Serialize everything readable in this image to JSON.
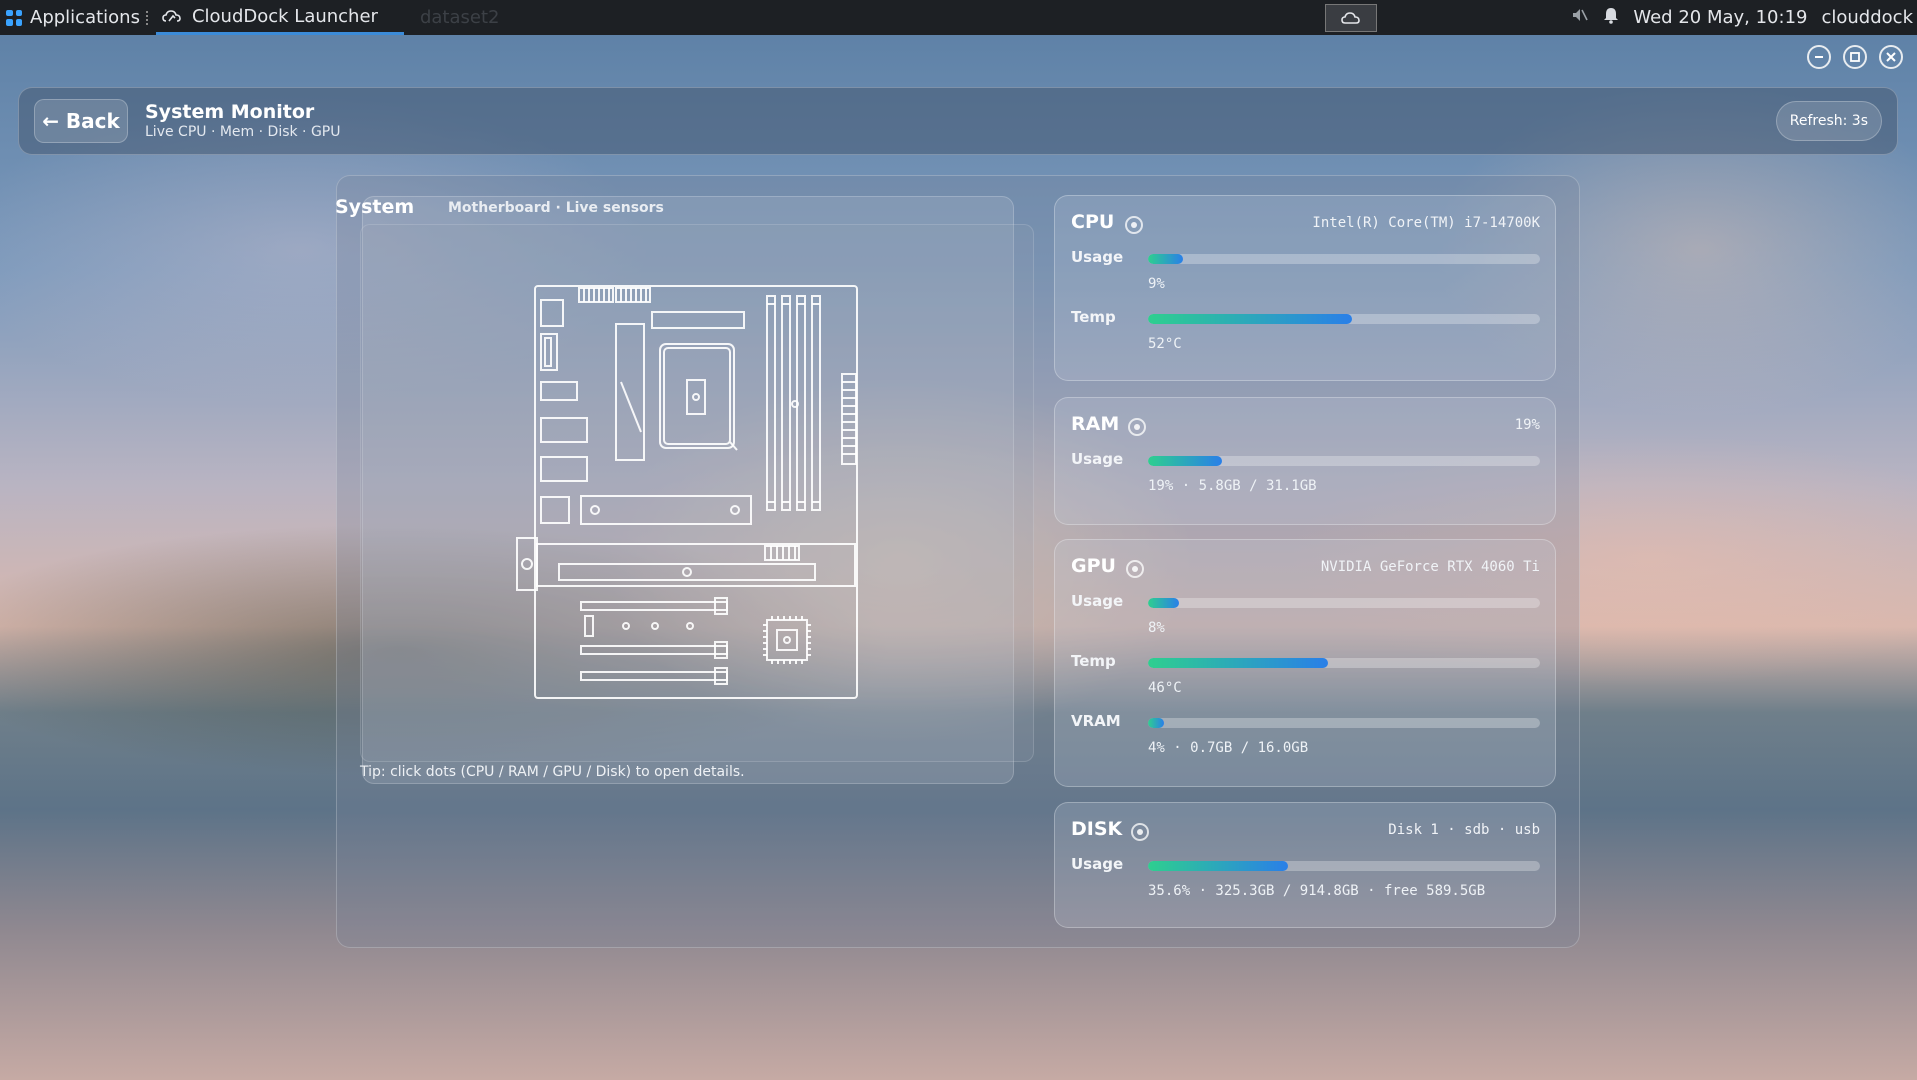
{
  "taskbar": {
    "applications_label": "Applications",
    "active_task_label": "CloudDock Launcher",
    "ghost_task_label": "dataset2",
    "datetime": "Wed 20 May, 10:19",
    "user": "clouddock"
  },
  "header": {
    "back_label": "← Back",
    "title": "System Monitor",
    "subtitle": "Live CPU · Mem · Disk · GPU",
    "refresh_label": "Refresh: 3s"
  },
  "system_panel": {
    "title": "System",
    "subtitle": "Motherboard · Live sensors",
    "tip": "Tip: click dots (CPU / RAM / GPU / Disk) to open details."
  },
  "cpu": {
    "title": "CPU",
    "info": "Intel(R) Core(TM) i7-14700K",
    "usage_label": "Usage",
    "usage_value": "9%",
    "usage_fraction": 0.09,
    "temp_label": "Temp",
    "temp_value": "52°C",
    "temp_fraction": 0.52
  },
  "ram": {
    "title": "RAM",
    "info": "19%",
    "usage_label": "Usage",
    "usage_value": "19% · 5.8GB / 31.1GB",
    "usage_fraction": 0.19
  },
  "gpu": {
    "title": "GPU",
    "info": "NVIDIA GeForce RTX 4060 Ti",
    "usage_label": "Usage",
    "usage_value": "8%",
    "usage_fraction": 0.08,
    "temp_label": "Temp",
    "temp_value": "46°C",
    "temp_fraction": 0.46,
    "vram_label": "VRAM",
    "vram_value": "4% · 0.7GB / 16.0GB",
    "vram_fraction": 0.04
  },
  "disk": {
    "title": "DISK",
    "info": "Disk 1 · sdb · usb",
    "usage_label": "Usage",
    "usage_value": "35.6% · 325.3GB / 914.8GB · free 589.5GB",
    "usage_fraction": 0.356
  }
}
